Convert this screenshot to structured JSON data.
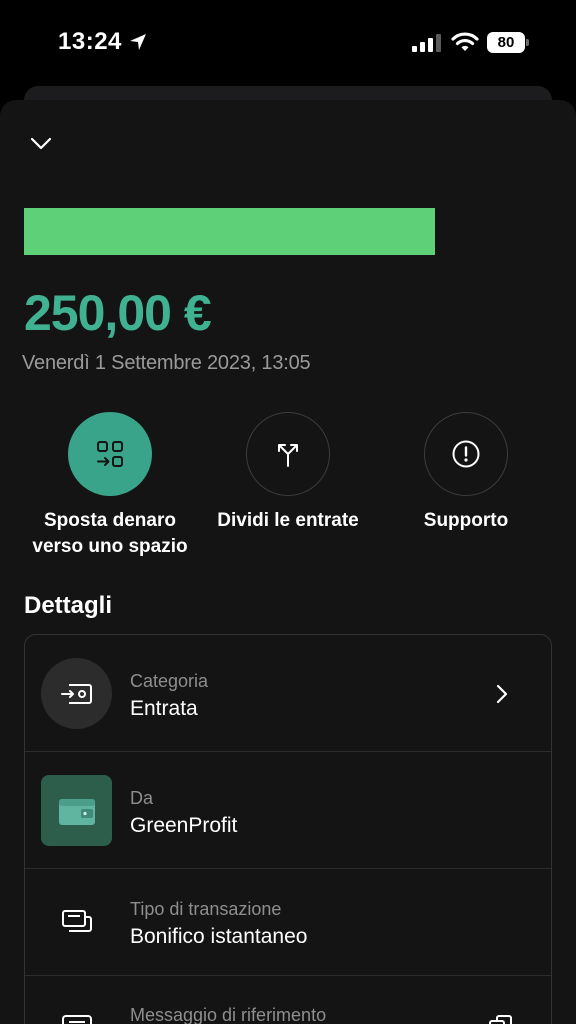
{
  "status_bar": {
    "time": "13:24",
    "battery": "80"
  },
  "header": {
    "collapse_icon": "chevron-down-icon"
  },
  "transaction": {
    "amount": "250,00 €",
    "date": "Venerdì 1 Settembre 2023, 13:05",
    "merchant_bar_color": "#5ed077",
    "amount_color": "#40b292"
  },
  "actions": [
    {
      "label_line1": "Sposta denaro",
      "label_line2": "verso uno spazio",
      "icon": "move-to-space-icon"
    },
    {
      "label_line1": "Dividi le entrate",
      "icon": "split-icon"
    },
    {
      "label_line1": "Supporto",
      "icon": "alert-circle-icon"
    }
  ],
  "details": {
    "title": "Dettagli",
    "rows": [
      {
        "label": "Categoria",
        "value": "Entrata",
        "icon": "income-icon"
      },
      {
        "label": "Da",
        "value": "GreenProfit",
        "icon": "wallet-icon"
      },
      {
        "label": "Tipo di transazione",
        "value": "Bonifico istantaneo",
        "icon": "transfer-icon"
      },
      {
        "label": "Messaggio di riferimento",
        "icon": "message-icon"
      }
    ]
  }
}
